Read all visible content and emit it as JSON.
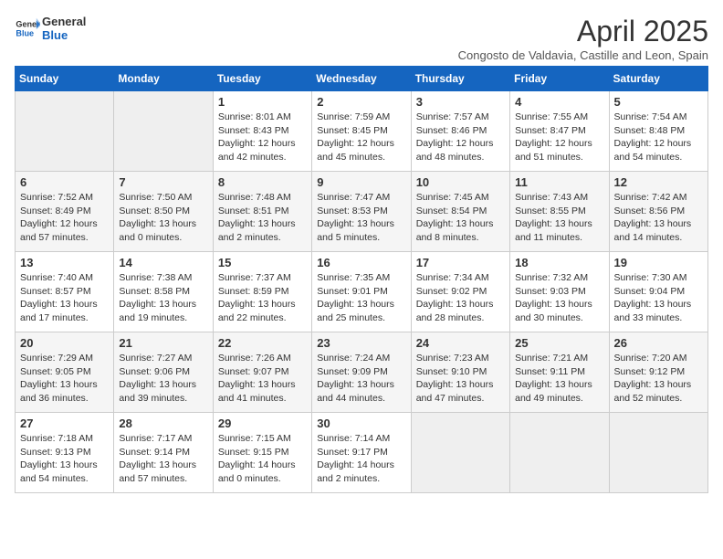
{
  "header": {
    "logo_line1": "General",
    "logo_line2": "Blue",
    "title": "April 2025",
    "subtitle": "Congosto de Valdavia, Castille and Leon, Spain"
  },
  "weekdays": [
    "Sunday",
    "Monday",
    "Tuesday",
    "Wednesday",
    "Thursday",
    "Friday",
    "Saturday"
  ],
  "weeks": [
    [
      {
        "day": "",
        "info": ""
      },
      {
        "day": "",
        "info": ""
      },
      {
        "day": "1",
        "info": "Sunrise: 8:01 AM\nSunset: 8:43 PM\nDaylight: 12 hours\nand 42 minutes."
      },
      {
        "day": "2",
        "info": "Sunrise: 7:59 AM\nSunset: 8:45 PM\nDaylight: 12 hours\nand 45 minutes."
      },
      {
        "day": "3",
        "info": "Sunrise: 7:57 AM\nSunset: 8:46 PM\nDaylight: 12 hours\nand 48 minutes."
      },
      {
        "day": "4",
        "info": "Sunrise: 7:55 AM\nSunset: 8:47 PM\nDaylight: 12 hours\nand 51 minutes."
      },
      {
        "day": "5",
        "info": "Sunrise: 7:54 AM\nSunset: 8:48 PM\nDaylight: 12 hours\nand 54 minutes."
      }
    ],
    [
      {
        "day": "6",
        "info": "Sunrise: 7:52 AM\nSunset: 8:49 PM\nDaylight: 12 hours\nand 57 minutes."
      },
      {
        "day": "7",
        "info": "Sunrise: 7:50 AM\nSunset: 8:50 PM\nDaylight: 13 hours\nand 0 minutes."
      },
      {
        "day": "8",
        "info": "Sunrise: 7:48 AM\nSunset: 8:51 PM\nDaylight: 13 hours\nand 2 minutes."
      },
      {
        "day": "9",
        "info": "Sunrise: 7:47 AM\nSunset: 8:53 PM\nDaylight: 13 hours\nand 5 minutes."
      },
      {
        "day": "10",
        "info": "Sunrise: 7:45 AM\nSunset: 8:54 PM\nDaylight: 13 hours\nand 8 minutes."
      },
      {
        "day": "11",
        "info": "Sunrise: 7:43 AM\nSunset: 8:55 PM\nDaylight: 13 hours\nand 11 minutes."
      },
      {
        "day": "12",
        "info": "Sunrise: 7:42 AM\nSunset: 8:56 PM\nDaylight: 13 hours\nand 14 minutes."
      }
    ],
    [
      {
        "day": "13",
        "info": "Sunrise: 7:40 AM\nSunset: 8:57 PM\nDaylight: 13 hours\nand 17 minutes."
      },
      {
        "day": "14",
        "info": "Sunrise: 7:38 AM\nSunset: 8:58 PM\nDaylight: 13 hours\nand 19 minutes."
      },
      {
        "day": "15",
        "info": "Sunrise: 7:37 AM\nSunset: 8:59 PM\nDaylight: 13 hours\nand 22 minutes."
      },
      {
        "day": "16",
        "info": "Sunrise: 7:35 AM\nSunset: 9:01 PM\nDaylight: 13 hours\nand 25 minutes."
      },
      {
        "day": "17",
        "info": "Sunrise: 7:34 AM\nSunset: 9:02 PM\nDaylight: 13 hours\nand 28 minutes."
      },
      {
        "day": "18",
        "info": "Sunrise: 7:32 AM\nSunset: 9:03 PM\nDaylight: 13 hours\nand 30 minutes."
      },
      {
        "day": "19",
        "info": "Sunrise: 7:30 AM\nSunset: 9:04 PM\nDaylight: 13 hours\nand 33 minutes."
      }
    ],
    [
      {
        "day": "20",
        "info": "Sunrise: 7:29 AM\nSunset: 9:05 PM\nDaylight: 13 hours\nand 36 minutes."
      },
      {
        "day": "21",
        "info": "Sunrise: 7:27 AM\nSunset: 9:06 PM\nDaylight: 13 hours\nand 39 minutes."
      },
      {
        "day": "22",
        "info": "Sunrise: 7:26 AM\nSunset: 9:07 PM\nDaylight: 13 hours\nand 41 minutes."
      },
      {
        "day": "23",
        "info": "Sunrise: 7:24 AM\nSunset: 9:09 PM\nDaylight: 13 hours\nand 44 minutes."
      },
      {
        "day": "24",
        "info": "Sunrise: 7:23 AM\nSunset: 9:10 PM\nDaylight: 13 hours\nand 47 minutes."
      },
      {
        "day": "25",
        "info": "Sunrise: 7:21 AM\nSunset: 9:11 PM\nDaylight: 13 hours\nand 49 minutes."
      },
      {
        "day": "26",
        "info": "Sunrise: 7:20 AM\nSunset: 9:12 PM\nDaylight: 13 hours\nand 52 minutes."
      }
    ],
    [
      {
        "day": "27",
        "info": "Sunrise: 7:18 AM\nSunset: 9:13 PM\nDaylight: 13 hours\nand 54 minutes."
      },
      {
        "day": "28",
        "info": "Sunrise: 7:17 AM\nSunset: 9:14 PM\nDaylight: 13 hours\nand 57 minutes."
      },
      {
        "day": "29",
        "info": "Sunrise: 7:15 AM\nSunset: 9:15 PM\nDaylight: 14 hours\nand 0 minutes."
      },
      {
        "day": "30",
        "info": "Sunrise: 7:14 AM\nSunset: 9:17 PM\nDaylight: 14 hours\nand 2 minutes."
      },
      {
        "day": "",
        "info": ""
      },
      {
        "day": "",
        "info": ""
      },
      {
        "day": "",
        "info": ""
      }
    ]
  ]
}
